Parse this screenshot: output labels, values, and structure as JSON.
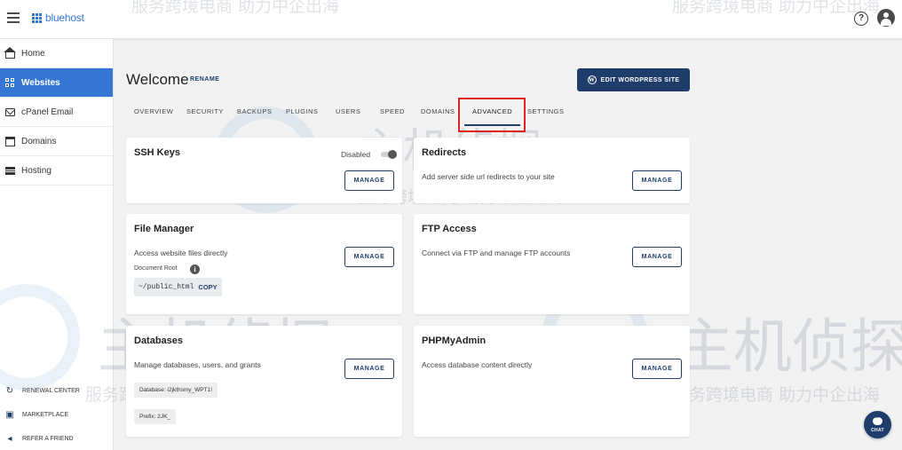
{
  "topbar": {
    "logo_text": "bluehost",
    "help_icon": "help-circle-icon",
    "help_glyph": "?",
    "user_icon": "account-circle-icon"
  },
  "sidebar": {
    "items": [
      {
        "label": "Home",
        "icon": "home-icon",
        "active": false
      },
      {
        "label": "Websites",
        "icon": "grid-icon",
        "active": true
      },
      {
        "label": "cPanel Email",
        "icon": "mail-icon",
        "active": false
      },
      {
        "label": "Domains",
        "icon": "domain-icon",
        "active": false
      },
      {
        "label": "Hosting",
        "icon": "server-icon",
        "active": false
      }
    ],
    "bottom_links": [
      {
        "label": "RENEWAL CENTER",
        "icon": "renew-icon"
      },
      {
        "label": "MARKETPLACE",
        "icon": "store-icon"
      },
      {
        "label": "REFER A FRIEND",
        "icon": "megaphone-icon"
      }
    ]
  },
  "main": {
    "title": "Welcome",
    "rename_label": "RENAME",
    "edit_button_label": "EDIT WORDPRESS SITE",
    "tabs": [
      "OVERVIEW",
      "SECURITY",
      "BACKUPS",
      "PLUGINS",
      "USERS",
      "SPEED",
      "DOMAINS",
      "ADVANCED",
      "SETTINGS"
    ],
    "active_tab": "ADVANCED"
  },
  "cards": {
    "ssh": {
      "title": "SSH Keys",
      "toggle_label": "Disabled",
      "manage": "MANAGE"
    },
    "redirects": {
      "title": "Redirects",
      "desc": "Add server side url redirects to your site",
      "manage": "MANAGE"
    },
    "file_manager": {
      "title": "File Manager",
      "desc": "Access website files directly",
      "doc_root_label": "Document Root",
      "info_glyph": "i",
      "path": "~/public_html",
      "copy": "COPY",
      "manage": "MANAGE"
    },
    "ftp": {
      "title": "FTP Access",
      "desc": "Connect via FTP and manage FTP accounts",
      "manage": "MANAGE"
    },
    "databases": {
      "title": "Databases",
      "desc": "Manage databases, users, and grants",
      "db_chip": "Database: i2jkthsmy_WPT1!",
      "prefix_chip": "Prefix: 2JK_",
      "manage": "MANAGE"
    },
    "phpmyadmin": {
      "title": "PHPMyAdmin",
      "desc": "Access database content directly",
      "manage": "MANAGE"
    }
  },
  "chat": {
    "label": "CHAT"
  },
  "watermark": {
    "line1": "服务跨境电商 助力中企出海",
    "brand": "主机侦探"
  },
  "colors": {
    "brand_blue": "#3575d3",
    "navy": "#1f3d6b",
    "highlight_red": "#dd2222"
  }
}
